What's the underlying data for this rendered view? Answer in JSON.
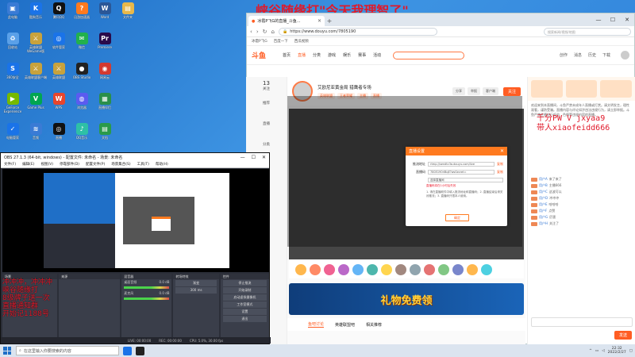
{
  "banner": {
    "text": "峡谷随缘打\"今天我理智了\""
  },
  "ad_right": {
    "line1": "千分PW V jxyaa9",
    "line2": "带人xiaofeidd666"
  },
  "desktop_icons": [
    {
      "label": "此电脑",
      "glyph": "▣",
      "color": "#3a7bd5"
    },
    {
      "label": "酷狗音乐",
      "glyph": "K",
      "color": "#1a73e8"
    },
    {
      "label": "腾讯QQ",
      "glyph": "Q",
      "color": "#111111"
    },
    {
      "label": "迅游加速器",
      "glyph": "?",
      "color": "#ff7a1f"
    },
    {
      "label": "Word",
      "glyph": "W",
      "color": "#2b5797"
    },
    {
      "label": "文件夹",
      "glyph": "▤",
      "color": "#e8b84a"
    },
    {
      "label": "回收站",
      "glyph": "♻",
      "color": "#5aa0e8"
    },
    {
      "label": "英雄联盟WeGame版",
      "glyph": "⚔",
      "color": "#c8a23c"
    },
    {
      "label": "软件管家",
      "glyph": "◎",
      "color": "#1a73e8"
    },
    {
      "label": "微信",
      "glyph": "✉",
      "color": "#22b14c"
    },
    {
      "label": "Premiere",
      "glyph": "Pr",
      "color": "#2a0a4a"
    },
    {
      "label": "",
      "glyph": "",
      "color": "transparent"
    },
    {
      "label": "360安全",
      "glyph": "S",
      "color": "#1a73e8"
    },
    {
      "label": "英雄联盟客户端",
      "glyph": "⚔",
      "color": "#c8a23c"
    },
    {
      "label": "英雄联盟",
      "glyph": "⚔",
      "color": "#c8a23c"
    },
    {
      "label": "OBS Studio",
      "glyph": "●",
      "color": "#222222"
    },
    {
      "label": "网易云",
      "glyph": "◉",
      "color": "#d33a31"
    },
    {
      "label": "",
      "glyph": "",
      "color": "transparent"
    },
    {
      "label": "GeForce Experience",
      "glyph": "▶",
      "color": "#76b900"
    },
    {
      "label": "Game Plus",
      "glyph": "V",
      "color": "#00a651"
    },
    {
      "label": "WPS",
      "glyph": "W",
      "color": "#e8452c"
    },
    {
      "label": "浏览器",
      "glyph": "◍",
      "color": "#5b5bf0"
    },
    {
      "label": "直播伴侣",
      "glyph": "▦",
      "color": "#2a8f4a"
    },
    {
      "label": "",
      "glyph": "",
      "color": "transparent"
    },
    {
      "label": "电脑管家",
      "glyph": "✓",
      "color": "#1a73e8"
    },
    {
      "label": "音频",
      "glyph": "≋",
      "color": "#3a7bd5"
    },
    {
      "label": "直播",
      "glyph": "◎",
      "color": "#111111"
    },
    {
      "label": "QQ音乐",
      "glyph": "♪",
      "color": "#2ec0a6"
    },
    {
      "label": "文档",
      "glyph": "▤",
      "color": "#2a9a4a"
    }
  ],
  "browser": {
    "tab_title": "冰雹P飞G的直播_斗鱼...",
    "url": "https://www.douyu.com/7805190",
    "search_placeholder": "搜索新闻/视频/地图",
    "bookmarks": [
      "冰雹P飞G",
      "百度一下",
      "西瓜视频"
    ],
    "back": "‹",
    "forward": "›",
    "refresh": "↻",
    "home": "⌂",
    "new_tab": "+",
    "minimize": "—",
    "maximize": "☐",
    "close": "✕"
  },
  "douyu": {
    "logo": "斗鱼",
    "nav": [
      "首页",
      "直播",
      "分类",
      "游戏",
      "娱乐",
      "赛事",
      "活动"
    ],
    "right": [
      "创作",
      "消息",
      "历史",
      "下载"
    ],
    "sidebar": [
      {
        "num": "13",
        "label": "关注"
      },
      {
        "num": "",
        "label": "推荐"
      },
      {
        "num": "",
        "label": "直播"
      },
      {
        "num": "",
        "label": "分类"
      },
      {
        "num": "",
        "label": "游戏"
      },
      {
        "num": "",
        "label": "赛事"
      },
      {
        "num": "",
        "label": "娱乐"
      },
      {
        "num": "",
        "label": "活动"
      }
    ],
    "room_title": "艾欧尼亚黄金局 猎鹰者专场",
    "tags": [
      "英雄联盟",
      "王者荣耀",
      "主播",
      "直播"
    ],
    "room_buttons": [
      "分享",
      "举报",
      "客户端"
    ],
    "follow": "关注",
    "promo": "礼物免费领",
    "bottom_tabs": [
      "鱼吧讨论",
      "英雄联盟吧",
      "相关推荐"
    ],
    "chat_notice": "欢迎来到本直播间，斗鱼严禁未成年人直播或打赏。请文明发言，理性观看，谨防受骗。直播内容与评论如涉违法违规行为，请立即举报。斗鱼严禁主播进行低俗、色情等违规内容的直播。",
    "chat_messages": [
      {
        "user": "用户A",
        "msg": "来了来了"
      },
      {
        "user": "用户B",
        "msg": "主播666"
      },
      {
        "user": "用户C",
        "msg": "这波可以"
      },
      {
        "user": "用户D",
        "msg": "冲冲冲"
      },
      {
        "user": "用户E",
        "msg": "哈哈哈"
      },
      {
        "user": "用户F",
        "msg": "点赞"
      },
      {
        "user": "用户G",
        "msg": "厉害"
      },
      {
        "user": "用户H",
        "msg": "关注了"
      }
    ],
    "chat_send": "发送"
  },
  "dialog": {
    "title": "直播设置",
    "server_label": "推流地址",
    "server_value": "rtmp://sendtc3a.douyu.com/live",
    "key_label": "直播码",
    "key_value": "7805190rlBqE?wsSecret=",
    "room_label": "",
    "room_value": "选择直播间",
    "copy1": "复制",
    "copy2": "复制",
    "warn": "直播码将在1小时后失效",
    "tips": "1. 请在直播软件中填入推流地址和直播码；2. 直播结束后请关闭推流；3. 直播码只限本人使用。",
    "ok": "确定"
  },
  "obs": {
    "title": "OBS 27.1.3 (64-bit, windows) - 配置文件: 未命名 - 场景: 未命名",
    "menu": [
      "文件(F)",
      "编辑(E)",
      "视图(V)",
      "停靠部件(D)",
      "配置文件(P)",
      "场景集合(S)",
      "工具(T)",
      "帮助(H)"
    ],
    "panel_scenes": "场景",
    "panel_sources": "来源",
    "panel_mixer": "混音器",
    "panel_transitions": "转场特效",
    "panel_controls": "控件",
    "mixer": [
      {
        "name": "桌面音频",
        "db": "0.0 dB"
      },
      {
        "name": "麦克风",
        "db": "0.0 dB"
      }
    ],
    "transition_mode": "渐变",
    "transition_duration": "300 ms",
    "controls": [
      "停止推流",
      "开始录制",
      "启动虚拟摄像机",
      "工作室模式",
      "设置",
      "退出"
    ],
    "status": [
      "LIVE: 00:00:00",
      "REC: 00:00:00",
      "CPU: 5.0%, 30.00 fps"
    ],
    "ad_lines": [
      "冲冲冲，冲冲冲",
      "峡谷随缘打",
      "8级牌子送一次",
      "直播通知群",
      "开始记1188号"
    ]
  },
  "taskbar": {
    "search_placeholder": "在这里输入你要搜索的内容",
    "time": "22:32",
    "date": "2022/2/27"
  },
  "colors": {
    "brand": "#ff5d23",
    "ad_red": "#e0192a",
    "obs_bg": "#2b2e38"
  }
}
